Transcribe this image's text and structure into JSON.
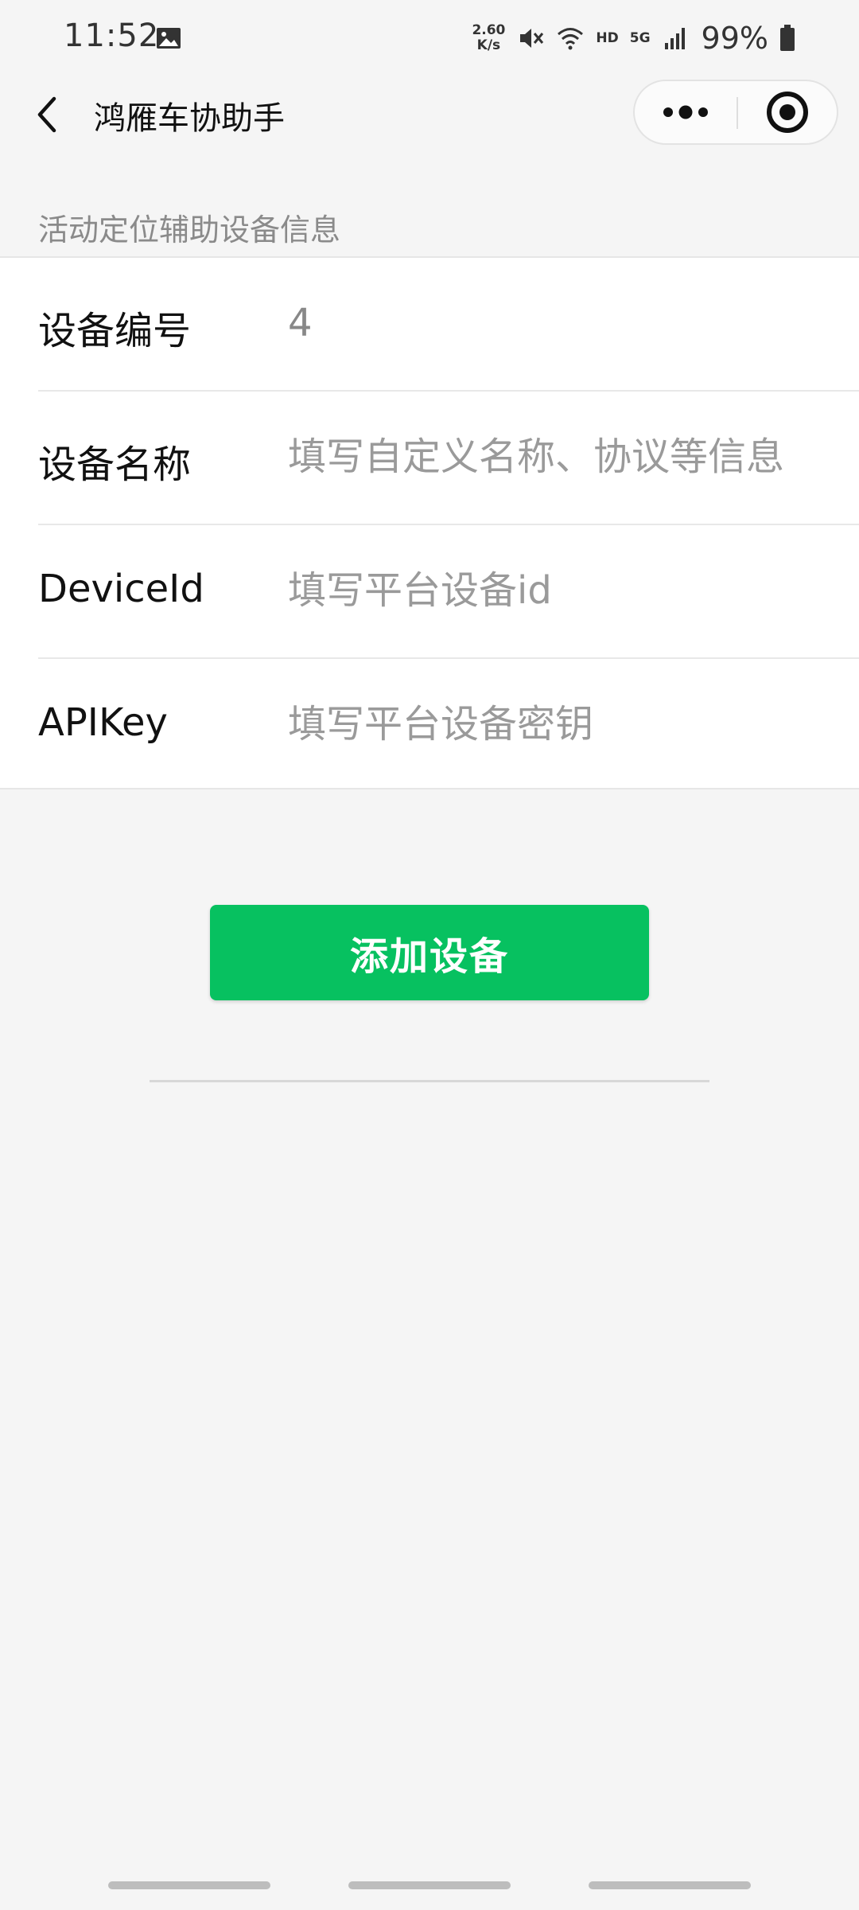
{
  "status_bar": {
    "time": "11:52",
    "net_speed_value": "2.60",
    "net_speed_unit": "K/s",
    "hd_label": "HD",
    "network_label": "5G",
    "battery": "99%",
    "icons": [
      "gallery-icon",
      "mute-icon",
      "wifi-icon",
      "signal-icon",
      "battery-icon"
    ]
  },
  "nav": {
    "title": "鸿雁车协助手",
    "icons": [
      "back-icon",
      "more-dots-icon",
      "close-circle-icon"
    ]
  },
  "section": {
    "title": "活动定位辅助设备信息"
  },
  "form": {
    "rows": [
      {
        "label": "设备编号",
        "value": "4",
        "placeholder": ""
      },
      {
        "label": "设备名称",
        "value": "",
        "placeholder": "填写自定义名称、协议等信息"
      },
      {
        "label": "DeviceId",
        "value": "",
        "placeholder": "填写平台设备id"
      },
      {
        "label": "APIKey",
        "value": "",
        "placeholder": "填写平台设备密钥"
      }
    ]
  },
  "actions": {
    "add_label": "添加设备"
  },
  "colors": {
    "accent": "#07c160",
    "background": "#f5f5f5",
    "card": "#ffffff",
    "muted_text": "#8a8a8a"
  }
}
